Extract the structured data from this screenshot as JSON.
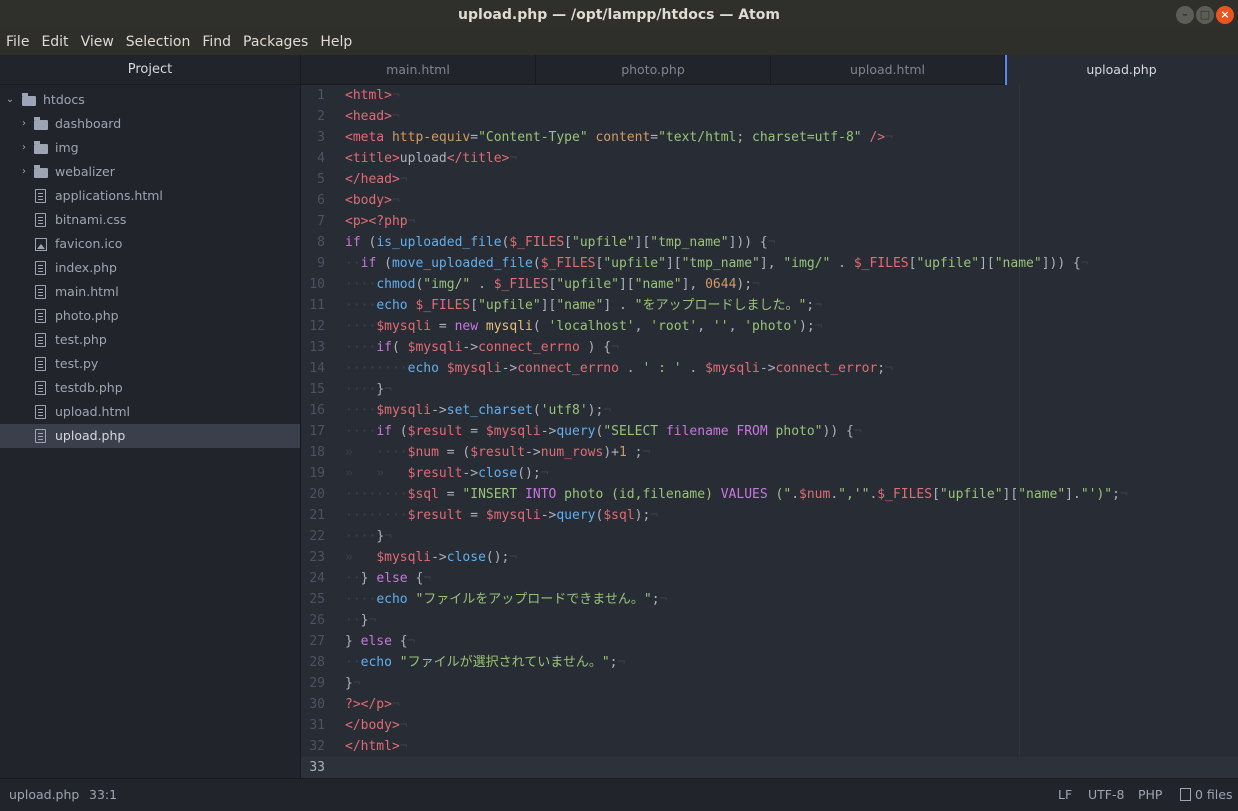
{
  "window": {
    "title": "upload.php — /opt/lampp/htdocs — Atom"
  },
  "menu": [
    "File",
    "Edit",
    "View",
    "Selection",
    "Find",
    "Packages",
    "Help"
  ],
  "sidebar": {
    "title": "Project",
    "root": "htdocs",
    "items": [
      {
        "name": "dashboard",
        "type": "folder"
      },
      {
        "name": "img",
        "type": "folder"
      },
      {
        "name": "webalizer",
        "type": "folder"
      },
      {
        "name": "applications.html",
        "type": "file"
      },
      {
        "name": "bitnami.css",
        "type": "file"
      },
      {
        "name": "favicon.ico",
        "type": "image"
      },
      {
        "name": "index.php",
        "type": "file"
      },
      {
        "name": "main.html",
        "type": "file"
      },
      {
        "name": "photo.php",
        "type": "file"
      },
      {
        "name": "test.php",
        "type": "file"
      },
      {
        "name": "test.py",
        "type": "file"
      },
      {
        "name": "testdb.php",
        "type": "file"
      },
      {
        "name": "upload.html",
        "type": "file"
      },
      {
        "name": "upload.php",
        "type": "file",
        "selected": true
      }
    ]
  },
  "tabs": [
    {
      "label": "main.html"
    },
    {
      "label": "photo.php"
    },
    {
      "label": "upload.html"
    },
    {
      "label": "upload.php",
      "active": true
    }
  ],
  "editor": {
    "cursor_line": 33,
    "lines": [
      [
        [
          "",
          ""
        ],
        [
          "tag",
          "<html>"
        ],
        [
          "inv",
          "¬"
        ]
      ],
      [
        [
          "tag",
          "<head>"
        ],
        [
          "inv",
          "¬"
        ]
      ],
      [
        [
          "tag",
          "<meta"
        ],
        [
          "p",
          " "
        ],
        [
          "attr",
          "http-equiv"
        ],
        [
          "p",
          "="
        ],
        [
          "str",
          "\"Content-Type\""
        ],
        [
          "p",
          " "
        ],
        [
          "attr",
          "content"
        ],
        [
          "p",
          "="
        ],
        [
          "str",
          "\"text/html; charset=utf-8\""
        ],
        [
          "p",
          " "
        ],
        [
          "tag",
          "/>"
        ],
        [
          "inv",
          "¬"
        ]
      ],
      [
        [
          "tag",
          "<title>"
        ],
        [
          "p",
          "upload"
        ],
        [
          "tag",
          "</title>"
        ],
        [
          "inv",
          "¬"
        ]
      ],
      [
        [
          "tag",
          "</head>"
        ],
        [
          "inv",
          "¬"
        ]
      ],
      [
        [
          "tag",
          "<body>"
        ],
        [
          "inv",
          "¬"
        ]
      ],
      [
        [
          "tag",
          "<p>"
        ],
        [
          "var",
          "<?php"
        ],
        [
          "inv",
          "¬"
        ]
      ],
      [
        [
          "kw",
          "if"
        ],
        [
          "p",
          " ("
        ],
        [
          "fn",
          "is_uploaded_file"
        ],
        [
          "p",
          "("
        ],
        [
          "var",
          "$_FILES"
        ],
        [
          "p",
          "["
        ],
        [
          "str",
          "\"upfile\""
        ],
        [
          "p",
          "]["
        ],
        [
          "str",
          "\"tmp_name\""
        ],
        [
          "p",
          "])) {"
        ],
        [
          "inv",
          "¬"
        ]
      ],
      [
        [
          "inv",
          "··"
        ],
        [
          "kw",
          "if"
        ],
        [
          "p",
          " ("
        ],
        [
          "fn",
          "move_uploaded_file"
        ],
        [
          "p",
          "("
        ],
        [
          "var",
          "$_FILES"
        ],
        [
          "p",
          "["
        ],
        [
          "str",
          "\"upfile\""
        ],
        [
          "p",
          "]["
        ],
        [
          "str",
          "\"tmp_name\""
        ],
        [
          "p",
          "], "
        ],
        [
          "str",
          "\"img/\""
        ],
        [
          "p",
          " . "
        ],
        [
          "var",
          "$_FILES"
        ],
        [
          "p",
          "["
        ],
        [
          "str",
          "\"upfile\""
        ],
        [
          "p",
          "]["
        ],
        [
          "str",
          "\"name\""
        ],
        [
          "p",
          "])) {"
        ],
        [
          "inv",
          "¬"
        ]
      ],
      [
        [
          "inv",
          "····"
        ],
        [
          "fn",
          "chmod"
        ],
        [
          "p",
          "("
        ],
        [
          "str",
          "\"img/\""
        ],
        [
          "p",
          " . "
        ],
        [
          "var",
          "$_FILES"
        ],
        [
          "p",
          "["
        ],
        [
          "str",
          "\"upfile\""
        ],
        [
          "p",
          "]["
        ],
        [
          "str",
          "\"name\""
        ],
        [
          "p",
          "], "
        ],
        [
          "num",
          "0644"
        ],
        [
          "p",
          ");"
        ],
        [
          "inv",
          "¬"
        ]
      ],
      [
        [
          "inv",
          "····"
        ],
        [
          "fn",
          "echo"
        ],
        [
          "p",
          " "
        ],
        [
          "var",
          "$_FILES"
        ],
        [
          "p",
          "["
        ],
        [
          "str",
          "\"upfile\""
        ],
        [
          "p",
          "]["
        ],
        [
          "str",
          "\"name\""
        ],
        [
          "p",
          "] . "
        ],
        [
          "str",
          "\"をアップロードしました。\""
        ],
        [
          "p",
          ";"
        ],
        [
          "inv",
          "¬"
        ]
      ],
      [
        [
          "inv",
          "····"
        ],
        [
          "var",
          "$mysqli"
        ],
        [
          "p",
          " = "
        ],
        [
          "kw",
          "new"
        ],
        [
          "p",
          " "
        ],
        [
          "cls",
          "mysqli"
        ],
        [
          "p",
          "( "
        ],
        [
          "str",
          "'localhost'"
        ],
        [
          "p",
          ", "
        ],
        [
          "str",
          "'root'"
        ],
        [
          "p",
          ", "
        ],
        [
          "str",
          "''"
        ],
        [
          "p",
          ", "
        ],
        [
          "str",
          "'photo'"
        ],
        [
          "p",
          ");"
        ],
        [
          "inv",
          "¬"
        ]
      ],
      [
        [
          "inv",
          "····"
        ],
        [
          "kw",
          "if"
        ],
        [
          "p",
          "( "
        ],
        [
          "var",
          "$mysqli"
        ],
        [
          "p",
          "->"
        ],
        [
          "var",
          "connect_errno"
        ],
        [
          "p",
          " ) {"
        ],
        [
          "inv",
          "¬"
        ]
      ],
      [
        [
          "inv",
          "········"
        ],
        [
          "fn",
          "echo"
        ],
        [
          "p",
          " "
        ],
        [
          "var",
          "$mysqli"
        ],
        [
          "p",
          "->"
        ],
        [
          "var",
          "connect_errno"
        ],
        [
          "p",
          " . "
        ],
        [
          "str",
          "' : '"
        ],
        [
          "p",
          " . "
        ],
        [
          "var",
          "$mysqli"
        ],
        [
          "p",
          "->"
        ],
        [
          "var",
          "connect_error"
        ],
        [
          "p",
          ";"
        ],
        [
          "inv",
          "¬"
        ]
      ],
      [
        [
          "inv",
          "····"
        ],
        [
          "p",
          "}"
        ],
        [
          "inv",
          "¬"
        ]
      ],
      [
        [
          "inv",
          "····"
        ],
        [
          "var",
          "$mysqli"
        ],
        [
          "p",
          "->"
        ],
        [
          "fn",
          "set_charset"
        ],
        [
          "p",
          "("
        ],
        [
          "str",
          "'utf8'"
        ],
        [
          "p",
          ");"
        ],
        [
          "inv",
          "¬"
        ]
      ],
      [
        [
          "inv",
          "····"
        ],
        [
          "kw",
          "if"
        ],
        [
          "p",
          " ("
        ],
        [
          "var",
          "$result"
        ],
        [
          "p",
          " = "
        ],
        [
          "var",
          "$mysqli"
        ],
        [
          "p",
          "->"
        ],
        [
          "fn",
          "query"
        ],
        [
          "p",
          "("
        ],
        [
          "str",
          "\"SELECT "
        ],
        [
          "kw",
          "filename"
        ],
        [
          "str",
          " "
        ],
        [
          "kw",
          "FROM"
        ],
        [
          "str",
          " photo\""
        ],
        [
          "p",
          ")) {"
        ],
        [
          "inv",
          "¬"
        ]
      ],
      [
        [
          "inv",
          "»   ····"
        ],
        [
          "var",
          "$num"
        ],
        [
          "p",
          " = ("
        ],
        [
          "var",
          "$result"
        ],
        [
          "p",
          "->"
        ],
        [
          "var",
          "num_rows"
        ],
        [
          "p",
          ")+"
        ],
        [
          "num",
          "1"
        ],
        [
          "p",
          " ;"
        ],
        [
          "inv",
          "¬"
        ]
      ],
      [
        [
          "inv",
          "»   »   "
        ],
        [
          "var",
          "$result"
        ],
        [
          "p",
          "->"
        ],
        [
          "fn",
          "close"
        ],
        [
          "p",
          "();"
        ],
        [
          "inv",
          "¬"
        ]
      ],
      [
        [
          "inv",
          "········"
        ],
        [
          "var",
          "$sql"
        ],
        [
          "p",
          " = "
        ],
        [
          "str",
          "\"INSERT "
        ],
        [
          "kw",
          "INTO"
        ],
        [
          "str",
          " photo (id,filename) "
        ],
        [
          "kw",
          "VALUES"
        ],
        [
          "str",
          " (\""
        ],
        [
          "p",
          "."
        ],
        [
          "var",
          "$num"
        ],
        [
          "p",
          "."
        ],
        [
          "str",
          "\",'\""
        ],
        [
          "p",
          "."
        ],
        [
          "var",
          "$_FILES"
        ],
        [
          "p",
          "["
        ],
        [
          "str",
          "\"upfile\""
        ],
        [
          "p",
          "]["
        ],
        [
          "str",
          "\"name\""
        ],
        [
          "p",
          "]."
        ],
        [
          "str",
          "\"')\""
        ],
        [
          "p",
          ";"
        ],
        [
          "inv",
          "¬"
        ]
      ],
      [
        [
          "inv",
          "········"
        ],
        [
          "var",
          "$result"
        ],
        [
          "p",
          " = "
        ],
        [
          "var",
          "$mysqli"
        ],
        [
          "p",
          "->"
        ],
        [
          "fn",
          "query"
        ],
        [
          "p",
          "("
        ],
        [
          "var",
          "$sql"
        ],
        [
          "p",
          ");"
        ],
        [
          "inv",
          "¬"
        ]
      ],
      [
        [
          "inv",
          "····"
        ],
        [
          "p",
          "}"
        ],
        [
          "inv",
          "¬"
        ]
      ],
      [
        [
          "inv",
          "»   "
        ],
        [
          "var",
          "$mysqli"
        ],
        [
          "p",
          "->"
        ],
        [
          "fn",
          "close"
        ],
        [
          "p",
          "();"
        ],
        [
          "inv",
          "¬"
        ]
      ],
      [
        [
          "inv",
          "··"
        ],
        [
          "p",
          "} "
        ],
        [
          "kw",
          "else"
        ],
        [
          "p",
          " {"
        ],
        [
          "inv",
          "¬"
        ]
      ],
      [
        [
          "inv",
          "····"
        ],
        [
          "fn",
          "echo"
        ],
        [
          "p",
          " "
        ],
        [
          "str",
          "\"ファイルをアップロードできません。\""
        ],
        [
          "p",
          ";"
        ],
        [
          "inv",
          "¬"
        ]
      ],
      [
        [
          "inv",
          "··"
        ],
        [
          "p",
          "}"
        ],
        [
          "inv",
          "¬"
        ]
      ],
      [
        [
          "p",
          "} "
        ],
        [
          "kw",
          "else"
        ],
        [
          "p",
          " {"
        ],
        [
          "inv",
          "¬"
        ]
      ],
      [
        [
          "inv",
          "··"
        ],
        [
          "fn",
          "echo"
        ],
        [
          "p",
          " "
        ],
        [
          "str",
          "\"ファイルが選択されていません。\""
        ],
        [
          "p",
          ";"
        ],
        [
          "inv",
          "¬"
        ]
      ],
      [
        [
          "p",
          "}"
        ],
        [
          "inv",
          "¬"
        ]
      ],
      [
        [
          "var",
          "?>"
        ],
        [
          "tag",
          "</p>"
        ],
        [
          "inv",
          "¬"
        ]
      ],
      [
        [
          "tag",
          "</body>"
        ],
        [
          "inv",
          "¬"
        ]
      ],
      [
        [
          "tag",
          "</html>"
        ],
        [
          "inv",
          "¬"
        ]
      ],
      []
    ]
  },
  "status": {
    "file": "upload.php",
    "position": "33:1",
    "line_ending": "LF",
    "encoding": "UTF-8",
    "grammar": "PHP",
    "git": "0 files"
  }
}
